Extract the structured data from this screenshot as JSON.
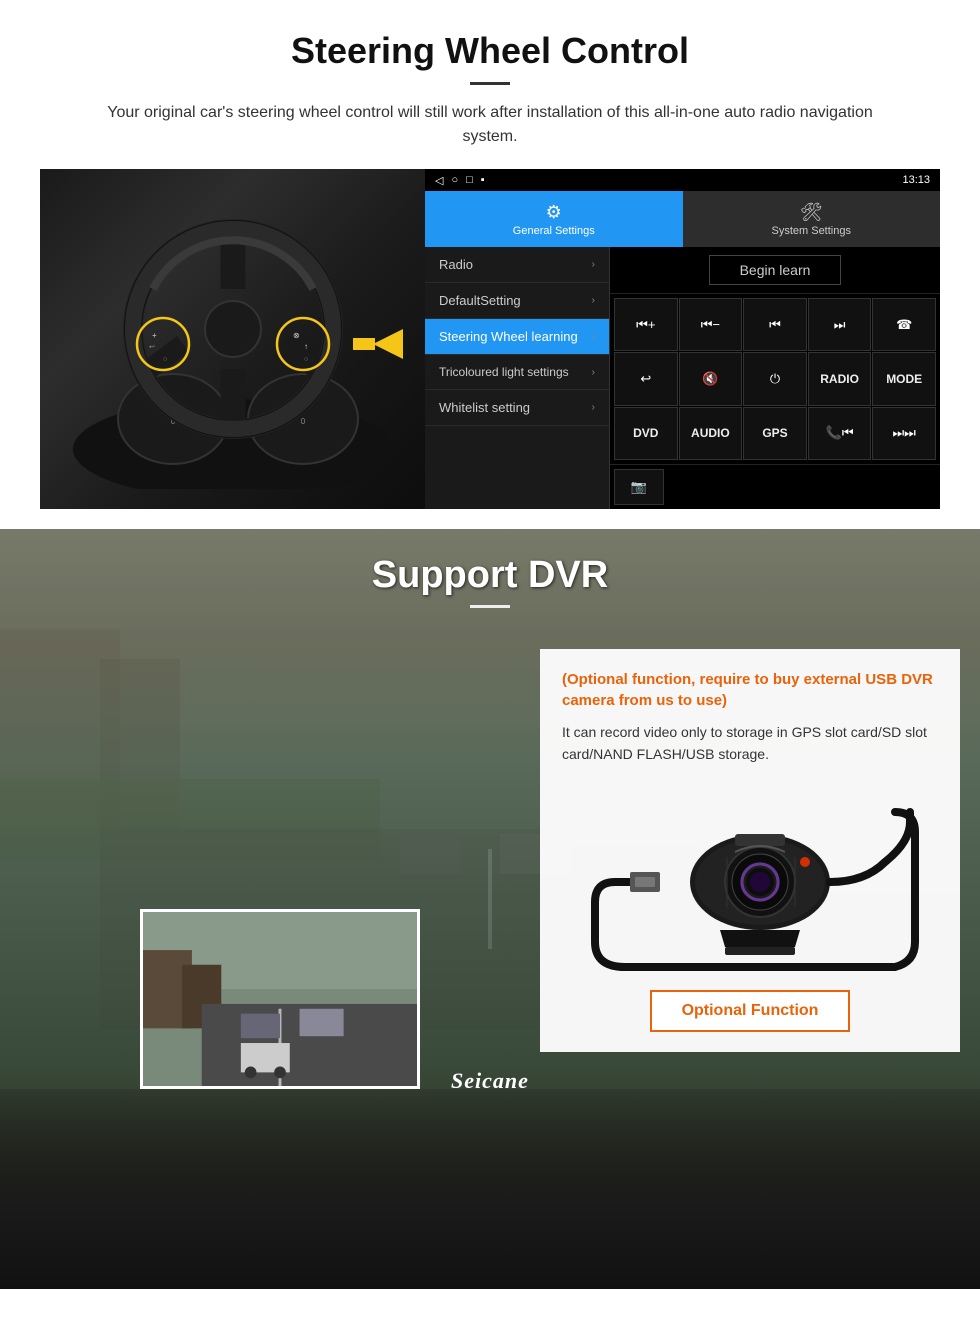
{
  "steering": {
    "title": "Steering Wheel Control",
    "subtitle": "Your original car's steering wheel control will still work after installation of this all-in-one auto radio navigation system.",
    "statusbar": {
      "time": "13:13",
      "icons": "▾ ▾"
    },
    "tabs": {
      "general": "General Settings",
      "system": "System Settings"
    },
    "menu_items": [
      {
        "label": "Radio",
        "active": false
      },
      {
        "label": "DefaultSetting",
        "active": false
      },
      {
        "label": "Steering Wheel learning",
        "active": true
      },
      {
        "label": "Tricoloured light settings",
        "active": false
      },
      {
        "label": "Whitelist setting",
        "active": false
      }
    ],
    "begin_learn": "Begin learn",
    "control_buttons": [
      "⏮+",
      "⏮−",
      "⏮⏮",
      "⏭",
      "☎",
      "↩",
      "🔇",
      "⏻",
      "RADIO",
      "MODE",
      "DVD",
      "AUDIO",
      "GPS",
      "📞⏮",
      "⏭⏭"
    ]
  },
  "dvr": {
    "title": "Support DVR",
    "optional_text": "(Optional function, require to buy external USB DVR camera from us to use)",
    "description": "It can record video only to storage in GPS slot card/SD slot card/NAND FLASH/USB storage.",
    "optional_function_label": "Optional Function",
    "seicane_brand": "Seicane"
  }
}
